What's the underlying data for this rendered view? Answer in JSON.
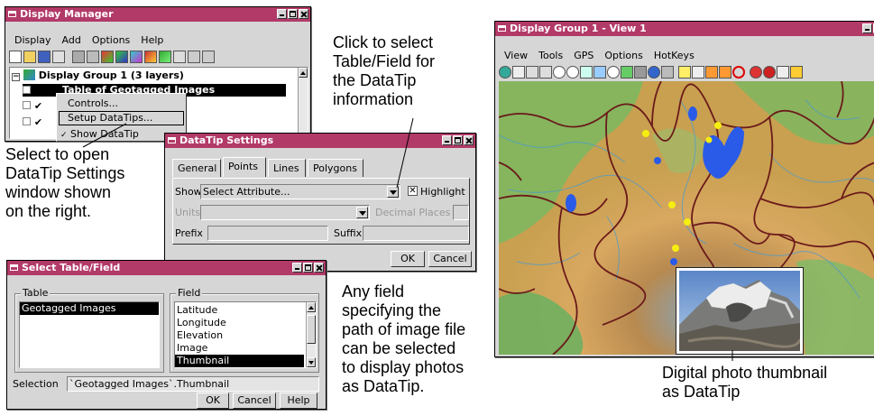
{
  "display_manager": {
    "title": "Display Manager",
    "menu": [
      "Display",
      "Add",
      "Options",
      "Help"
    ],
    "group_label": "Display Group 1  (3 layers)",
    "layer1_label": "Table of Geotagged Images",
    "context_menu": [
      "Controls...",
      "Setup DataTips...",
      "Show DataTip"
    ]
  },
  "datatip_settings": {
    "title": "DataTip Settings",
    "tabs": [
      "General",
      "Points",
      "Lines",
      "Polygons"
    ],
    "show_label": "Show",
    "show_value": "Select Attribute...",
    "highlight_label": "Highlight",
    "units_label": "Units",
    "decimal_places_label": "Decimal Places",
    "prefix_label": "Prefix",
    "suffix_label": "Suffix",
    "ok_label": "OK",
    "cancel_label": "Cancel"
  },
  "select_table_field": {
    "title": "Select Table/Field",
    "table_label": "Table",
    "tables": [
      "Geotagged Images"
    ],
    "field_label": "Field",
    "fields": [
      "Latitude",
      "Longitude",
      "Elevation",
      "Image",
      "Thumbnail"
    ],
    "selected_field": "Thumbnail",
    "selection_label": "Selection",
    "selection_value": "`Geotagged Images`.Thumbnail",
    "ok_label": "OK",
    "cancel_label": "Cancel",
    "help_label": "Help"
  },
  "view_window": {
    "title": "Display Group 1 - View 1",
    "menu": [
      "View",
      "Tools",
      "GPS",
      "Options",
      "HotKeys"
    ]
  },
  "callouts": {
    "click_select": [
      "Click to select",
      "Table/Field for",
      "the DataTip",
      "information"
    ],
    "select_open": [
      "Select to open",
      "DataTip Settings",
      "window shown",
      "on the right."
    ],
    "any_field": [
      "Any field",
      "specifying the",
      "path of image file",
      "can be selected",
      "to display photos",
      "as DataTip."
    ],
    "thumbnail": [
      "Digital photo thumbnail",
      "as DataTip"
    ]
  },
  "colors": {
    "titlebar": "#b23a68",
    "window_bg": "#d6d6d6",
    "selection": "#000000",
    "lake": "#2a5be8",
    "point": "#f5ee10",
    "boundary": "#6b1a1a"
  }
}
